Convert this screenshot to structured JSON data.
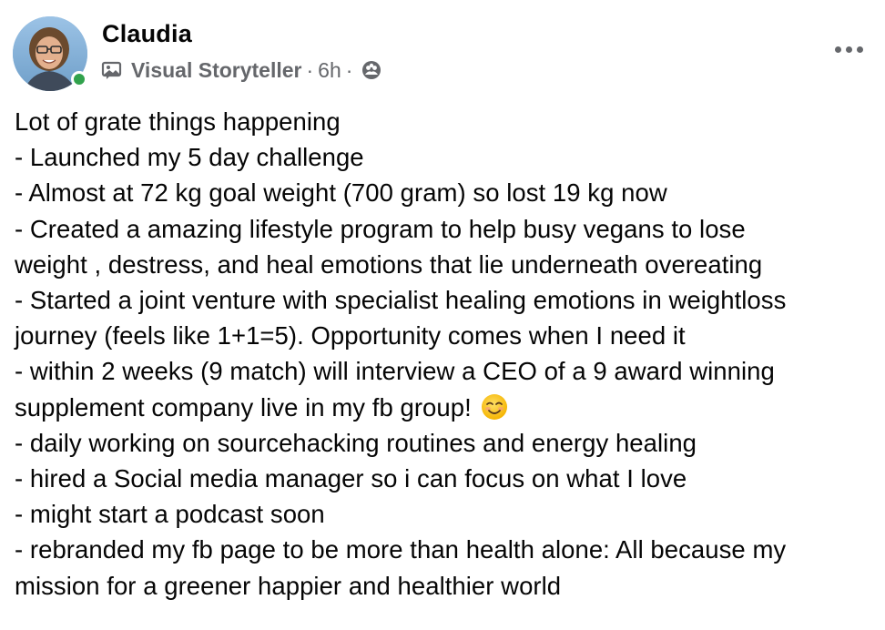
{
  "post": {
    "author": "Claudia",
    "badge_label": "Visual Storyteller",
    "separator_1": "·",
    "time": "6h",
    "separator_2": "·",
    "audience_icon": "friends-icon",
    "badge_icon": "picture-badge-icon",
    "more_icon": "more-options-icon",
    "online_status_color": "#31a24c",
    "lines": [
      "Lot of grate things happening",
      "- Launched my 5 day challenge",
      "- Almost at 72 kg goal weight (700 gram) so lost 19 kg now",
      "- Created a amazing lifestyle program to help busy vegans to lose",
      "weight , destress, and heal emotions that lie underneath overeating",
      "- Started a joint venture with specialist healing emotions in weightloss",
      "journey (feels like 1+1=5). Opportunity comes when I need it",
      "- within 2 weeks (9 match) will interview a CEO of a 9 award winning",
      "supplement company live in my fb group!",
      "- daily working on sourcehacking routines and energy healing",
      "- hired a Social media manager so i can focus on what I love",
      "- might start a podcast soon",
      "- rebranded my fb page to be more than health alone:  All because my",
      "mission for a greener happier and healthier world"
    ],
    "emoji": "smiling-face-emoji"
  }
}
